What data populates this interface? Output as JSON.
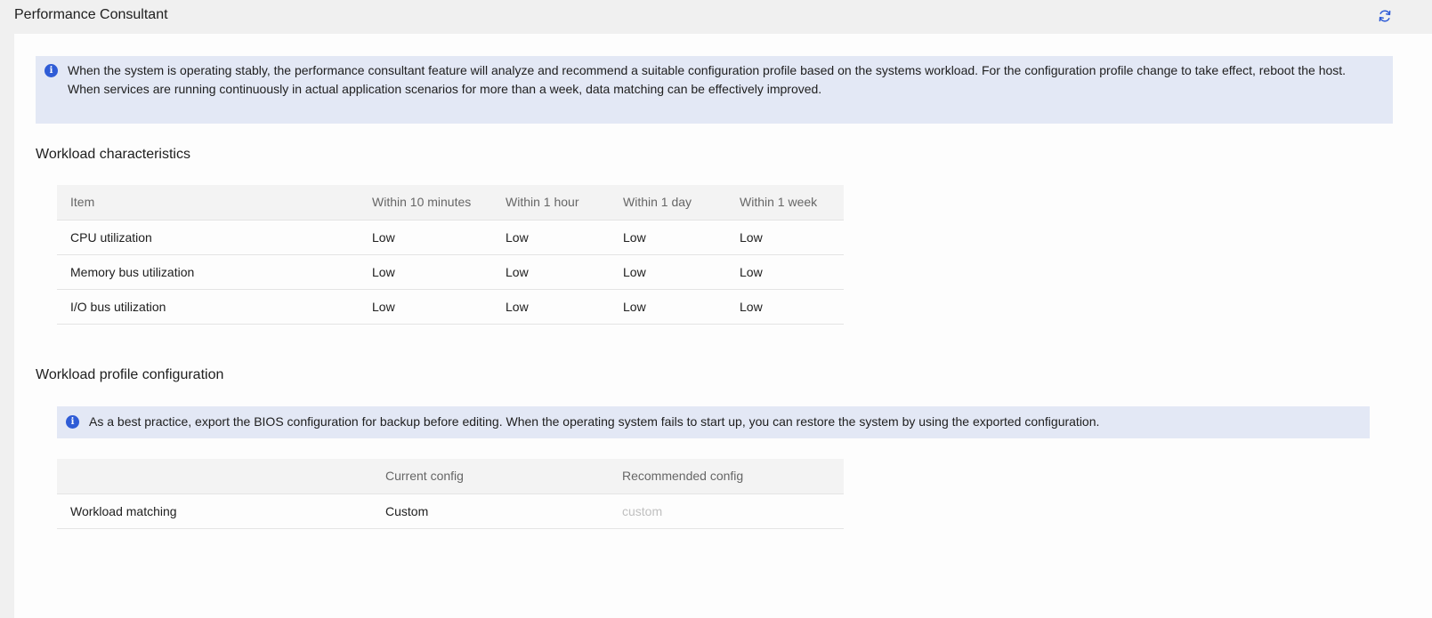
{
  "header": {
    "title": "Performance Consultant",
    "refresh_icon": "refresh-icon"
  },
  "info_banner": {
    "icon": "info-icon",
    "line1": "When the system is operating stably, the performance consultant feature will analyze and recommend a suitable configuration profile based on the systems workload. For the configuration profile change to take effect, reboot the host.",
    "line2": "When services are running continuously in actual application scenarios for more than a week, data matching can be effectively improved."
  },
  "workload_characteristics": {
    "title": "Workload characteristics",
    "columns": [
      "Item",
      "Within 10 minutes",
      "Within 1 hour",
      "Within 1 day",
      "Within 1 week"
    ],
    "rows": [
      [
        "CPU utilization",
        "Low",
        "Low",
        "Low",
        "Low"
      ],
      [
        "Memory bus utilization",
        "Low",
        "Low",
        "Low",
        "Low"
      ],
      [
        "I/O bus utilization",
        "Low",
        "Low",
        "Low",
        "Low"
      ]
    ]
  },
  "workload_profile": {
    "title": "Workload profile configuration",
    "banner": {
      "icon": "info-icon",
      "text": "As a best practice, export the BIOS configuration for backup before editing. When the operating system fails to start up, you can restore the system by using the exported configuration."
    },
    "columns": [
      "",
      "Current config",
      "Recommended config"
    ],
    "rows": [
      [
        "Workload matching",
        "Custom",
        "custom"
      ]
    ]
  },
  "colors": {
    "accent": "#2f5cd6",
    "banner_bg": "#e3e8f5",
    "header_row_bg": "#f3f3f3",
    "muted_text": "#c0c0c0"
  }
}
